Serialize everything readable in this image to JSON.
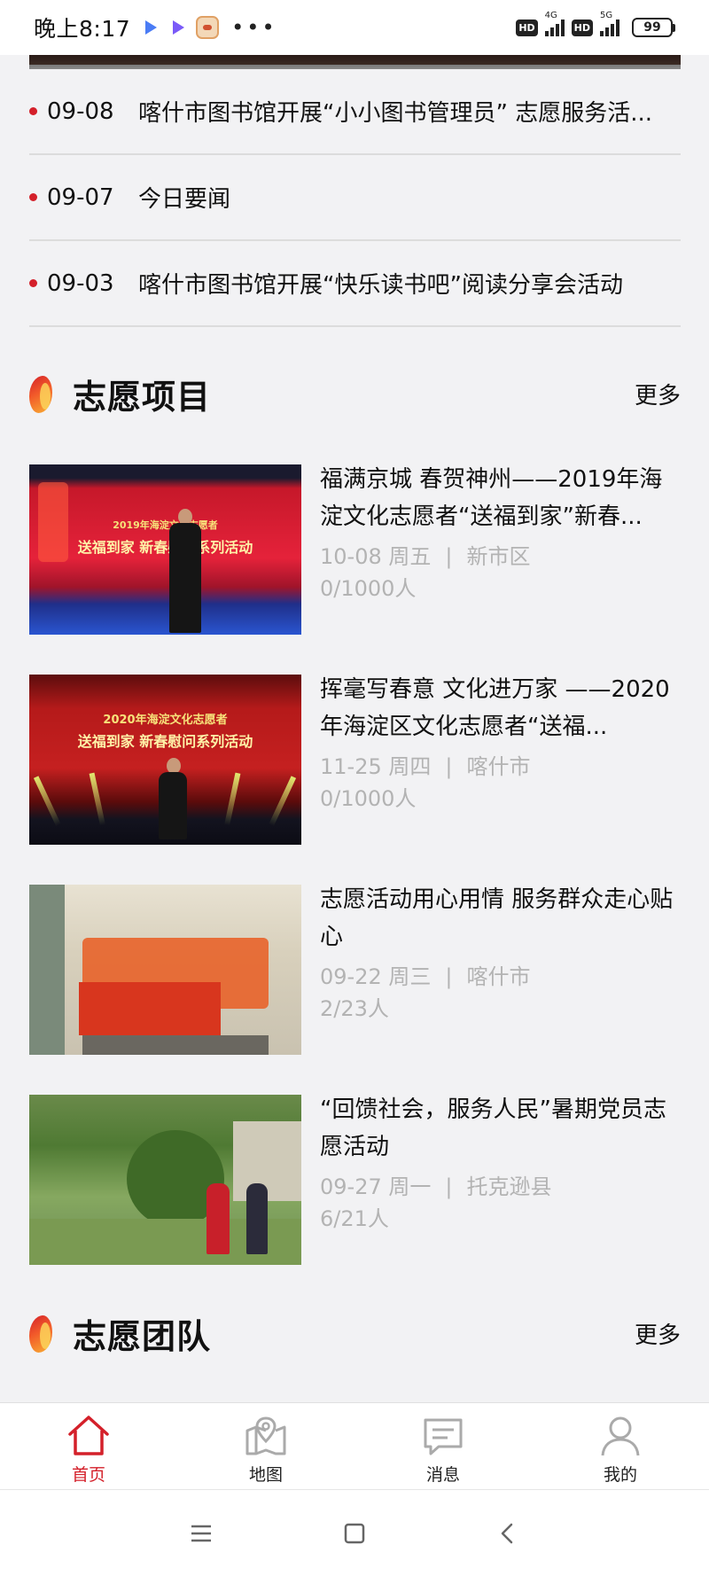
{
  "status_bar": {
    "time": "晚上8:17",
    "dots": "•••",
    "hd1": "HD",
    "hd2": "HD",
    "net1": "4G",
    "net2": "5G",
    "battery": "99"
  },
  "news": [
    {
      "date": "09-08",
      "title": "喀什市图书馆开展“小小图书管理员” 志愿服务活..."
    },
    {
      "date": "09-07",
      "title": "今日要闻"
    },
    {
      "date": "09-03",
      "title": "喀什市图书馆开展“快乐读书吧”阅读分享会活动"
    }
  ],
  "projects_section": {
    "title": "志愿项目",
    "more": "更多"
  },
  "projects": [
    {
      "title": "福满京城 春贺神州——2019年海淀文化志愿者“送福到家”新春...",
      "date": "10-08 周五",
      "place": "新市区",
      "count": "0/1000人",
      "banner_line1": "2019年海淀文化志愿者",
      "banner_line2": "送福到家 新春慰问系列活动"
    },
    {
      "title": "挥毫写春意 文化进万家 ——2020年海淀区文化志愿者“送福...",
      "date": "11-25 周四",
      "place": "喀什市",
      "count": "0/1000人",
      "banner_line1": "2020年海淀文化志愿者",
      "banner_line2": "送福到家 新春慰问系列活动"
    },
    {
      "title": "志愿活动用心用情 服务群众走心贴心",
      "date": "09-22 周三",
      "place": "喀什市",
      "count": "2/23人"
    },
    {
      "title": "“回馈社会，服务人民”暑期党员志愿活动",
      "date": "09-27 周一",
      "place": "托克逊县",
      "count": "6/21人"
    }
  ],
  "meta_separator": "|",
  "teams_section": {
    "title": "志愿团队",
    "more": "更多"
  },
  "tabbar": [
    {
      "label": "首页",
      "icon": "home-icon",
      "active": true
    },
    {
      "label": "地图",
      "icon": "map-icon",
      "active": false
    },
    {
      "label": "消息",
      "icon": "message-icon",
      "active": false
    },
    {
      "label": "我的",
      "icon": "profile-icon",
      "active": false
    }
  ],
  "colors": {
    "accent": "#d4202a",
    "meta": "#b3b3b3",
    "background": "#f2f2f4"
  }
}
